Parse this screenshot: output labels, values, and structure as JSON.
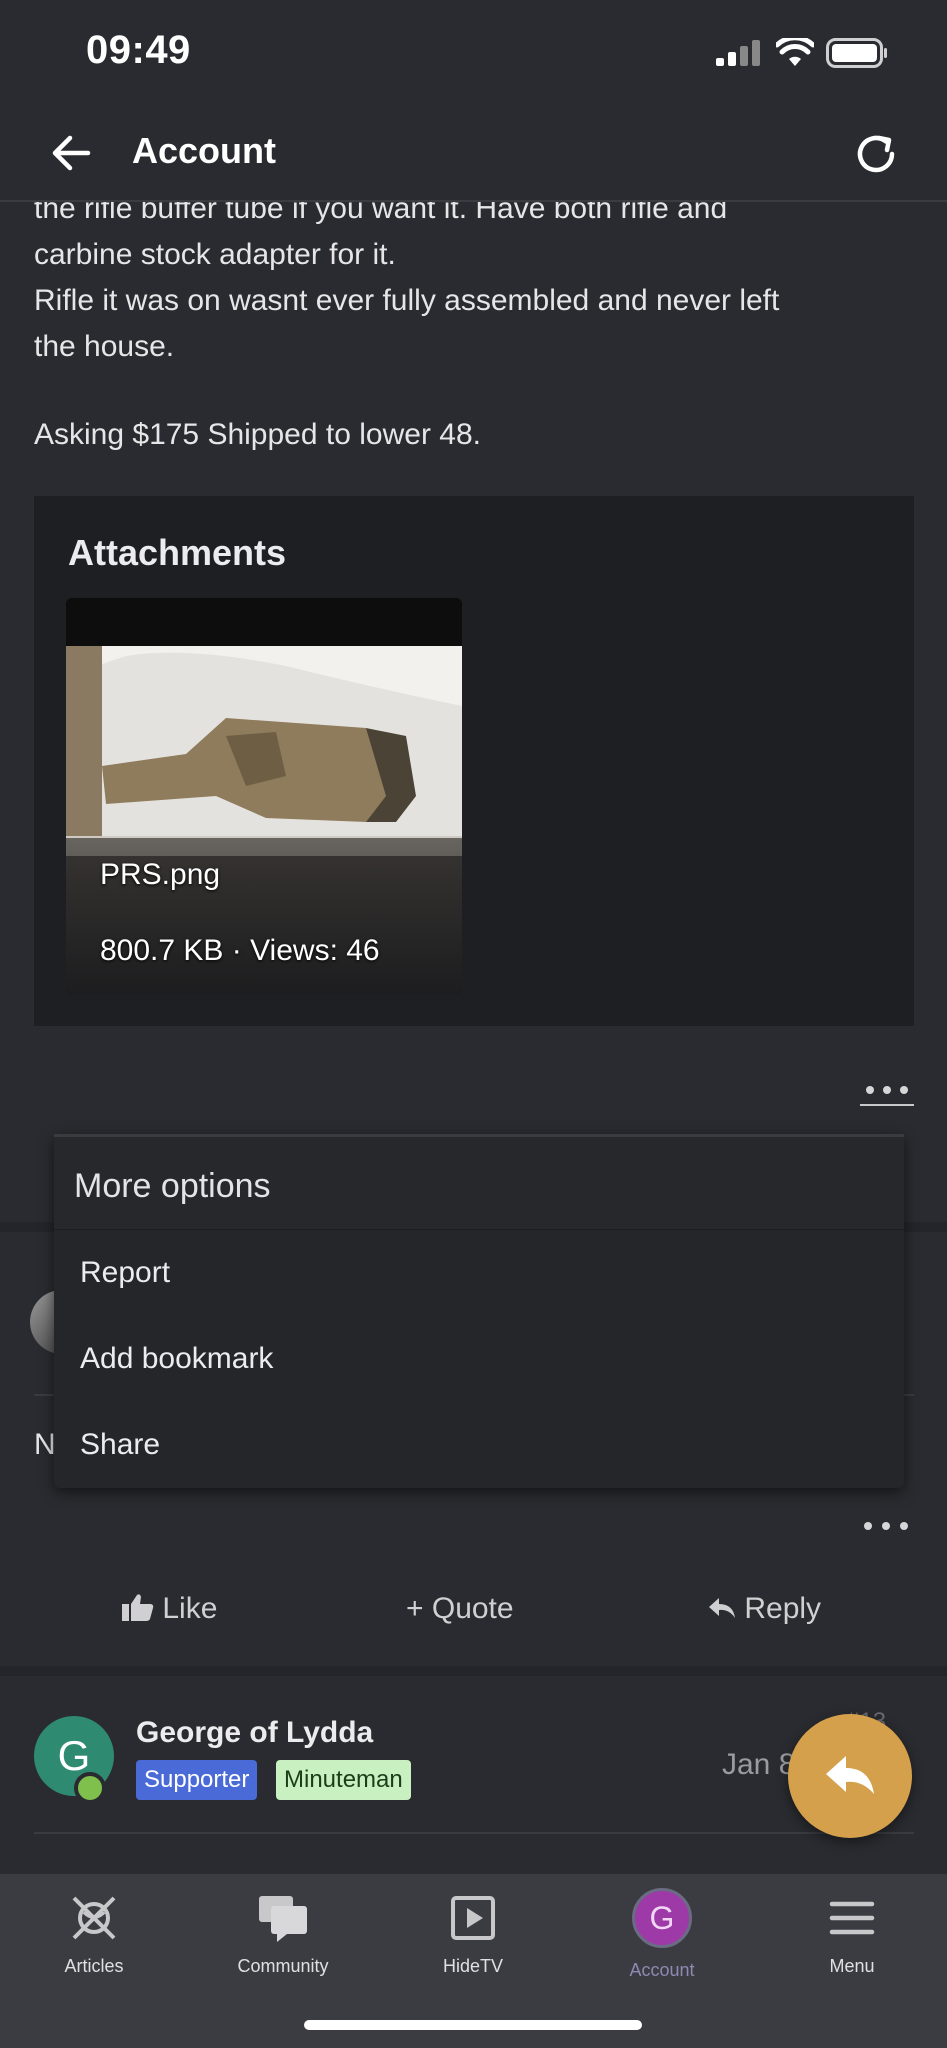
{
  "status_bar": {
    "time": "09:49"
  },
  "header": {
    "title": "Account"
  },
  "post": {
    "lines": [
      "the rifle buffer tube if you want it. Have both rifle and",
      "carbine stock adapter for it.",
      "Rifle it was on wasnt ever fully assembled and never left",
      "the house."
    ],
    "asking": "Asking $175 Shipped to lower 48."
  },
  "attachments": {
    "title": "Attachments",
    "items": [
      {
        "filename": "PRS.png",
        "meta": "800.7 KB · Views: 46"
      }
    ]
  },
  "more_menu": {
    "title": "More options",
    "items": [
      "Report",
      "Add bookmark",
      "Share"
    ]
  },
  "peek": {
    "letter": "N"
  },
  "actions": {
    "like": "Like",
    "quote": "+ Quote",
    "reply": "Reply"
  },
  "next_post": {
    "avatar_letter": "G",
    "author": "George of Lydda",
    "badges": [
      "Supporter",
      "Minuteman"
    ],
    "date": "Jan 8",
    "number": "#13"
  },
  "bottom_nav": {
    "items": [
      {
        "label": "Articles",
        "icon": "articles-icon"
      },
      {
        "label": "Community",
        "icon": "chat-bubbles-icon"
      },
      {
        "label": "HideTV",
        "icon": "play-icon"
      },
      {
        "label": "Account",
        "icon": "avatar",
        "avatar_letter": "G",
        "active": true
      },
      {
        "label": "Menu",
        "icon": "hamburger-icon"
      }
    ]
  },
  "colors": {
    "background": "#2a2b30",
    "fab": "#d4a04c",
    "supporter_badge": "#4a6ad8",
    "minuteman_badge": "#c9f0c0",
    "account_avatar": "#9d3aa8"
  }
}
